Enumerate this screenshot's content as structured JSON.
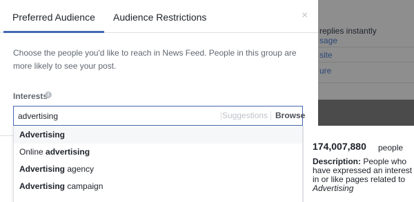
{
  "tabs": [
    {
      "label": "Preferred Audience",
      "active": true
    },
    {
      "label": "Audience Restrictions",
      "active": false
    }
  ],
  "close_symbol": "×",
  "description": "Choose the people you'd like to reach in News Feed. People in this group are more likely to see your post.",
  "interests": {
    "label": "Interests",
    "info_symbol": "i"
  },
  "search": {
    "value": "advertising",
    "suggestions_label": "Suggestions",
    "browse_label": "Browse"
  },
  "dropdown": {
    "options": [
      {
        "bold": "Advertising",
        "rest": ""
      },
      {
        "prefix": "Online ",
        "bold": "advertising"
      },
      {
        "bold": "Advertising",
        "rest": " agency"
      },
      {
        "bold": "Advertising",
        "rest": " campaign"
      }
    ]
  },
  "audience_panel": {
    "size": "174,007,880",
    "size_unit": "people",
    "description_label": "Description:",
    "description_text": " People who have expressed an interest in or like pages related to ",
    "description_term": "Advertising"
  },
  "background": {
    "line1": "replies instantly",
    "line2": "sage",
    "line3": "site",
    "line4": "ure"
  },
  "colors": {
    "accent": "#4267b2",
    "overlay": "#4b4b4b"
  }
}
